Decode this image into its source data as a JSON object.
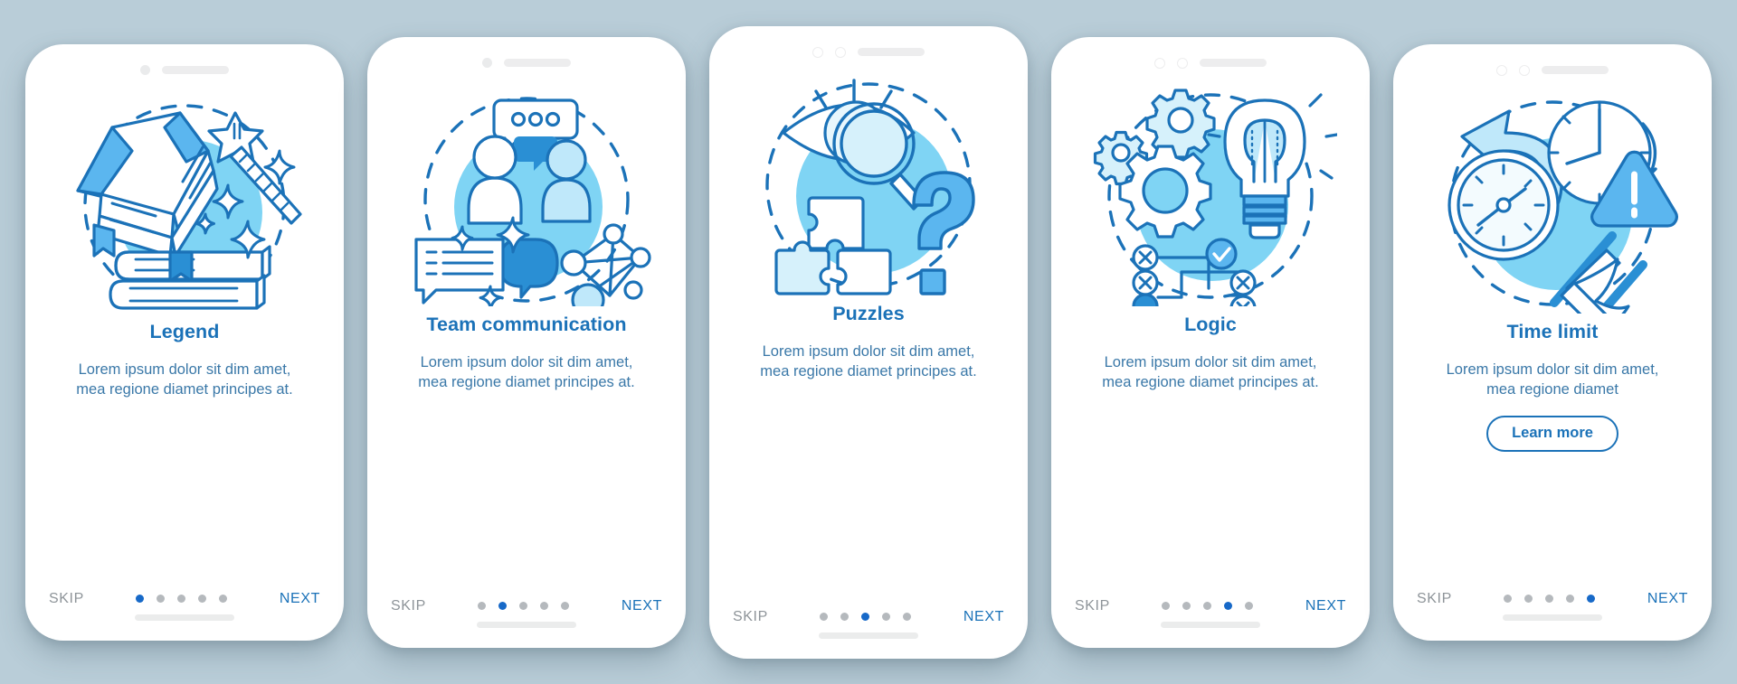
{
  "theme": {
    "background": "#b9cdd8",
    "card_background": "#ffffff",
    "accent": "#1b72b8",
    "accent_dot": "#1769c8",
    "dot_inactive": "#b5b9bd",
    "body_text": "#3a78a8",
    "skip_text": "#8e9499",
    "blob_fill": "#7fd4f4",
    "line_stroke": "#1b72b8"
  },
  "screens": [
    {
      "id": "legend",
      "illustration": "book-magic-wand-icon",
      "title": "Legend",
      "description": "Lorem ipsum dolor sit dim amet, mea regione diamet principes at.",
      "skip_label": "SKIP",
      "next_label": "NEXT",
      "dot_count": 5,
      "active_dot": 1,
      "notch_style": "single-dot",
      "learn_more_label": null
    },
    {
      "id": "team-communication",
      "illustration": "people-chat-network-icon",
      "title": "Team communication",
      "description": "Lorem ipsum dolor sit dim amet, mea regione diamet principes at.",
      "skip_label": "SKIP",
      "next_label": "NEXT",
      "dot_count": 5,
      "active_dot": 2,
      "notch_style": "single-dot",
      "learn_more_label": null
    },
    {
      "id": "puzzles",
      "illustration": "eye-magnifier-puzzle-question-icon",
      "title": "Puzzles",
      "description": "Lorem ipsum dolor sit dim amet, mea regione diamet principes at.",
      "skip_label": "SKIP",
      "next_label": "NEXT",
      "dot_count": 5,
      "active_dot": 3,
      "notch_style": "two-rings",
      "learn_more_label": null
    },
    {
      "id": "logic",
      "illustration": "gears-brain-bulb-icon",
      "title": "Logic",
      "description": "Lorem ipsum dolor sit dim amet, mea regione diamet principes at.",
      "skip_label": "SKIP",
      "next_label": "NEXT",
      "dot_count": 5,
      "active_dot": 4,
      "notch_style": "two-rings",
      "learn_more_label": null
    },
    {
      "id": "time-limit",
      "illustration": "clock-hourglass-warning-icon",
      "title": "Time limit",
      "description": "Lorem ipsum dolor sit dim amet, mea regione diamet",
      "skip_label": "SKIP",
      "next_label": "NEXT",
      "dot_count": 5,
      "active_dot": 5,
      "notch_style": "two-rings",
      "learn_more_label": "Learn more"
    }
  ]
}
